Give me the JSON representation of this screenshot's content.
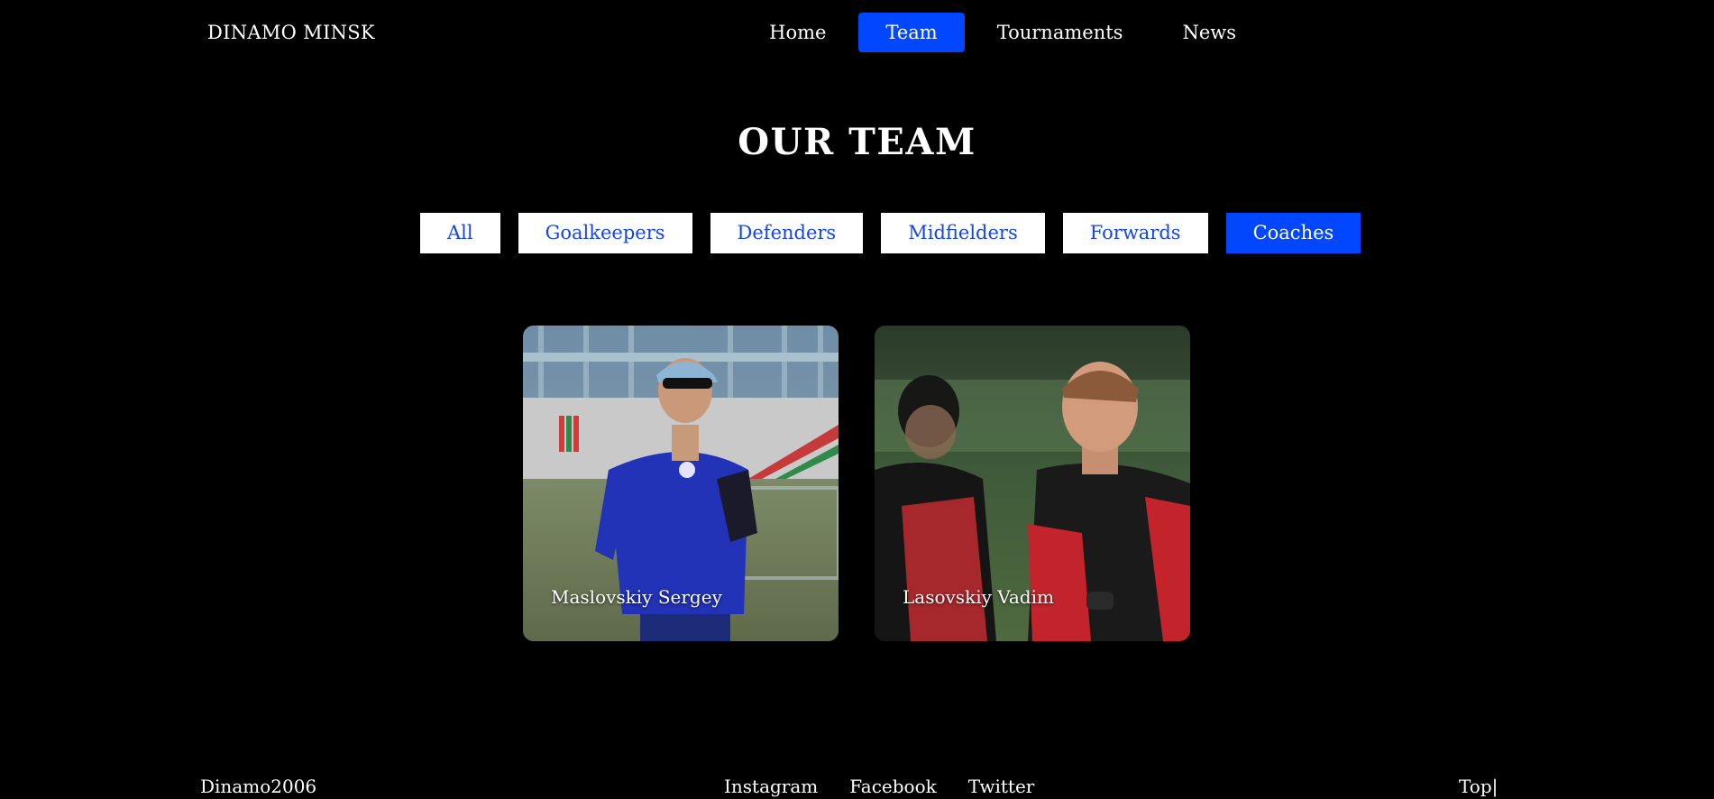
{
  "header": {
    "brand": "DINAMO MINSK",
    "nav": [
      {
        "label": "Home",
        "active": false
      },
      {
        "label": "Team",
        "active": true
      },
      {
        "label": "Tournaments",
        "active": false
      },
      {
        "label": "News",
        "active": false
      }
    ]
  },
  "main": {
    "title": "OUR TEAM",
    "filters": [
      {
        "label": "All",
        "active": false
      },
      {
        "label": "Goalkeepers",
        "active": false
      },
      {
        "label": "Defenders",
        "active": false
      },
      {
        "label": "Midfielders",
        "active": false
      },
      {
        "label": "Forwards",
        "active": false
      },
      {
        "label": "Coaches",
        "active": true
      }
    ],
    "cards": [
      {
        "name": "Maslovskiy Sergey"
      },
      {
        "name": "Lasovskiy Vadim"
      }
    ]
  },
  "footer": {
    "brand": "Dinamo2006",
    "links": [
      "Instagram",
      "Facebook",
      "Twitter"
    ],
    "top_label": "Top|"
  },
  "colors": {
    "background": "#000000",
    "accent": "#0047ff",
    "filter_text": "#1646e6",
    "text": "#ffffff"
  }
}
